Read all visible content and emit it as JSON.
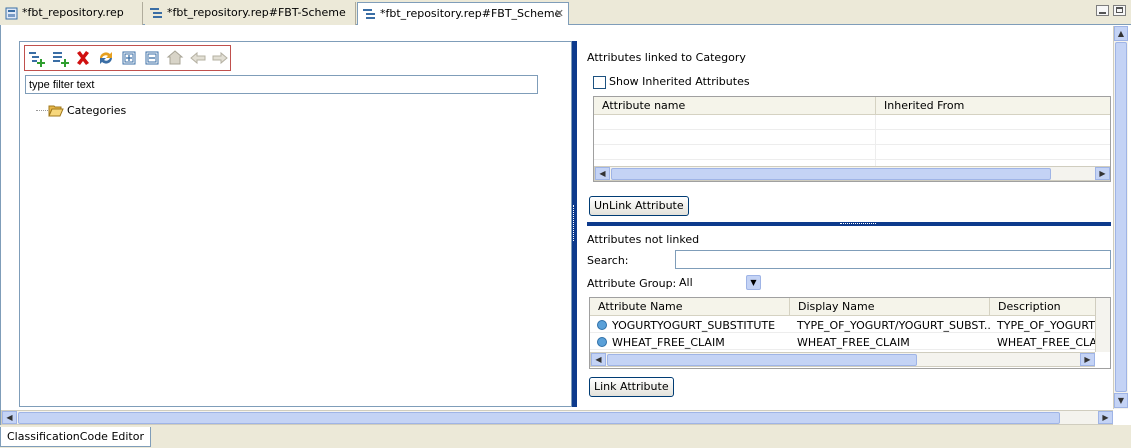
{
  "tabs": [
    {
      "label": "*fbt_repository.rep",
      "active": false
    },
    {
      "label": "*fbt_repository.rep#FBT-Scheme",
      "active": false
    },
    {
      "label": "*fbt_repository.rep#FBT_Scheme",
      "active": true,
      "close": "✕"
    }
  ],
  "toolbar": {
    "icons": [
      "add-child-icon",
      "add-sibling-icon",
      "delete-icon",
      "refresh-icon",
      "expand-all-icon",
      "collapse-all-icon",
      "home-icon",
      "back-icon",
      "forward-icon"
    ]
  },
  "tree": {
    "filter_value": "type filter text",
    "root_label": "Categories"
  },
  "linked": {
    "title": "Attributes linked to Category",
    "show_inherited_label": "Show Inherited Attributes",
    "show_inherited_checked": false,
    "columns": [
      "Attribute name",
      "Inherited From"
    ],
    "unlink_label": "UnLink Attribute"
  },
  "notlinked": {
    "title": "Attributes not linked",
    "search_label": "Search:",
    "search_value": "",
    "group_label": "Attribute Group:",
    "group_value": "All",
    "columns": [
      "Attribute Name",
      "Display Name",
      "Description"
    ],
    "rows": [
      {
        "name": "YOGURTYOGURT_SUBSTITUTE",
        "display": "TYPE_OF_YOGURT/YOGURT_SUBST...",
        "description": "TYPE_OF_YOGURT/YO"
      },
      {
        "name": "WHEAT_FREE_CLAIM",
        "display": "WHEAT_FREE_CLAIM",
        "description": "WHEAT_FREE_CLAIM"
      }
    ],
    "link_label": "Link Attribute"
  },
  "status": {
    "editor_tab": "ClassificationCode Editor"
  },
  "colors": {
    "accent": "#0d3a8c",
    "toolbar_border": "#c0504d"
  }
}
